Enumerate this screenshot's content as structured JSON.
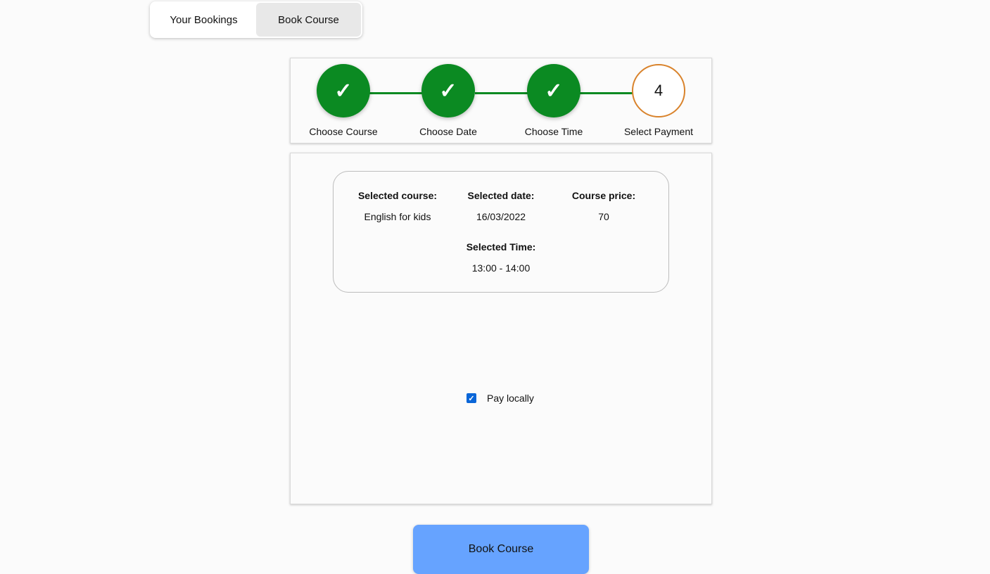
{
  "tabs": {
    "bookings_label": "Your Bookings",
    "book_course_label": "Book Course",
    "active": "Book Course"
  },
  "stepper": {
    "steps": [
      {
        "label": "Choose Course",
        "status": "done",
        "symbol": "✓"
      },
      {
        "label": "Choose Date",
        "status": "done",
        "symbol": "✓"
      },
      {
        "label": "Choose Time",
        "status": "done",
        "symbol": "✓"
      },
      {
        "label": "Select Payment",
        "status": "current",
        "symbol": "4"
      }
    ]
  },
  "summary": {
    "course_label": "Selected course:",
    "course_value": "English for kids",
    "date_label": "Selected date:",
    "date_value": "16/03/2022",
    "price_label": "Course price:",
    "price_value": "70",
    "time_label": "Selected Time:",
    "time_value": "13:00 - 14:00"
  },
  "payment": {
    "pay_locally_label": "Pay locally",
    "pay_locally_checked": true
  },
  "actions": {
    "book_course_button": "Book Course"
  },
  "colors": {
    "step_done": "#0b8a22",
    "step_current_border": "#d9832c",
    "button": "#66a3ff",
    "checkbox": "#0a66d8"
  }
}
